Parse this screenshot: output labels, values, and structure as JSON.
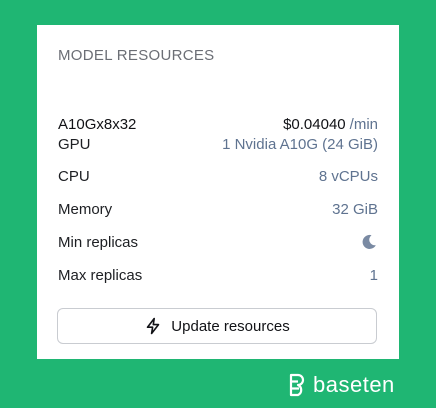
{
  "card": {
    "title": "MODEL RESOURCES",
    "instance": {
      "name": "A10Gx8x32",
      "price": "$0.04040",
      "price_unit": "/min"
    },
    "rows": [
      {
        "label": "GPU",
        "value": "1 Nvidia A10G (24 GiB)"
      },
      {
        "label": "CPU",
        "value": "8 vCPUs"
      },
      {
        "label": "Memory",
        "value": "32 GiB"
      },
      {
        "label": "Min replicas",
        "icon": "moon-icon"
      },
      {
        "label": "Max replicas",
        "value": "1"
      }
    ],
    "update_button": {
      "label": "Update resources",
      "icon": "lightning-bolt-icon"
    }
  },
  "brand": {
    "name": "baseten",
    "icon": "baseten-logo-icon"
  },
  "colors": {
    "background": "#1fb673",
    "value_text": "#5f7390",
    "label_text": "#1d1f23"
  }
}
